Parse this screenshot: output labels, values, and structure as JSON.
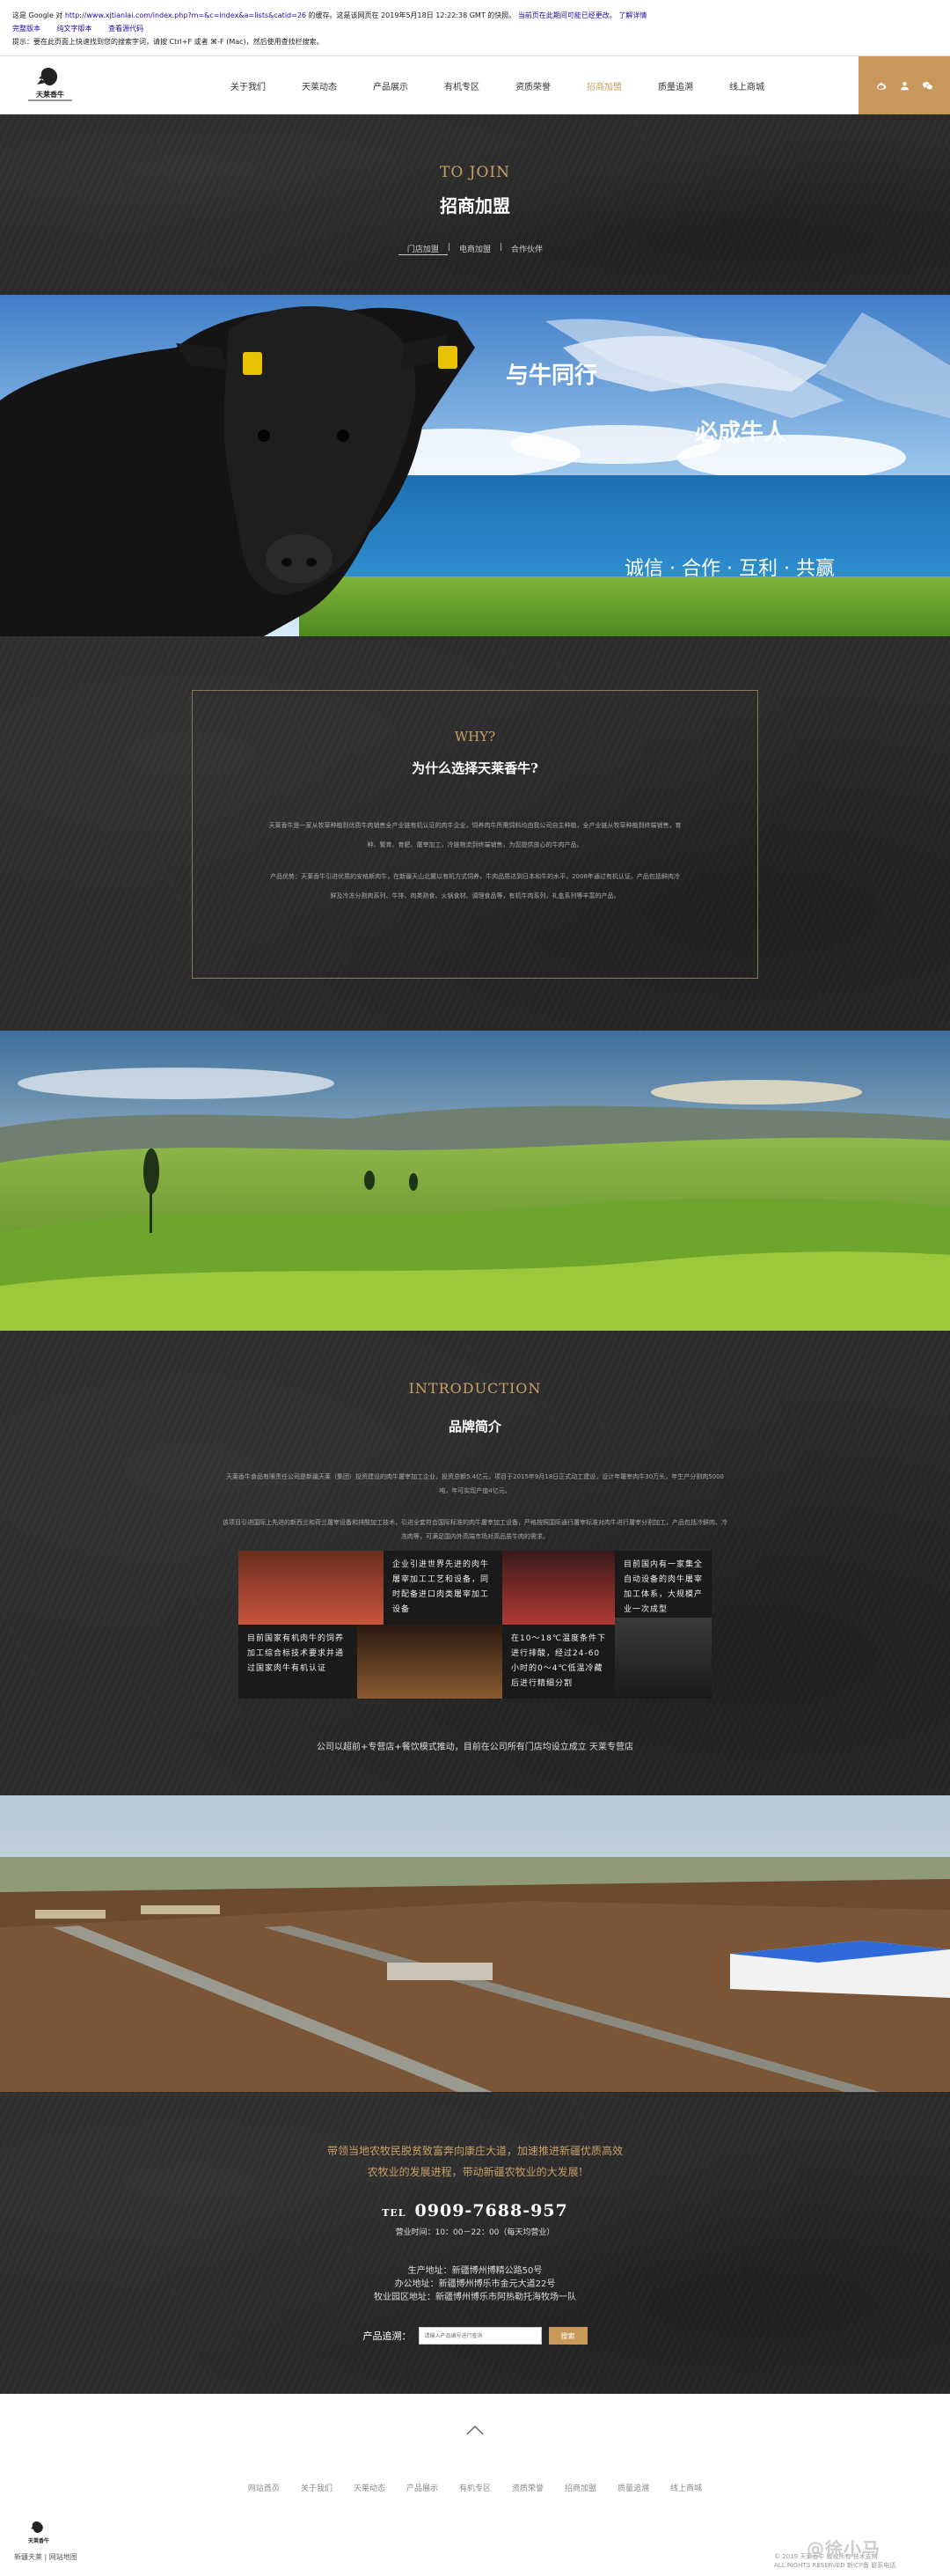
{
  "cache_bar": {
    "line1_prefix": "这是 Google 对",
    "url": "http://www.xjtianlai.com/index.php?m=&c=index&a=lists&catid=26",
    "line1_suffix": "的缓存。这是该网页在 2019年5月18日 12:22:38 GMT 的快照。",
    "line1_note": "当前页在此期间可能已经更改。",
    "learn_more": "了解详情",
    "full_version": "完整版本",
    "text_only": "纯文字版本",
    "view_source": "查看源代码",
    "tip": "提示：要在此页面上快速找到您的搜索字词，请按 Ctrl+F 或者 ⌘-F (Mac)，然后使用查找栏搜索。"
  },
  "nav": {
    "logo_text": "天莱香牛",
    "items": [
      "关于我们",
      "天莱动态",
      "产品展示",
      "有机专区",
      "资质荣誉",
      "招商加盟",
      "质量追溯",
      "线上商城"
    ],
    "active_index": 5,
    "accent": "#c8995a"
  },
  "join": {
    "title_en": "TO JOIN",
    "title_cn": "招商加盟",
    "tabs": [
      "门店加盟",
      "电商加盟",
      "合作伙伴"
    ]
  },
  "banner": {
    "slogan1": "与牛同行",
    "slogan2": "必成牛人",
    "values": "诚信 · 合作 · 互利 · 共赢"
  },
  "why": {
    "title_en": "WHY?",
    "title_cn": "为什么选择天莱香牛?",
    "p1": "天莱香牛是一家从牧草种植到优质牛肉销售全产业链有机认证的肉牛企业，饲养肉牛所需饲料均由我公司自主种植，全产业链从牧草种植到终端销售，育种、繁育、育肥、屠宰加工，冷链物流到终端销售，为您提供放心的牛肉产品。",
    "p2": "产品优势：天莱香牛引进优质的安格斯肉牛，在新疆天山北麓以有机方式饲养，牛肉品质达到日本和牛的水平，2008年通过有机认证。产品包括鲜肉冷鲜及冷冻分割肉系列、牛排、肉类熟食、火锅食材、调理食品等，有机牛肉系列，礼盒系列等丰富的产品。"
  },
  "intro": {
    "title_en": "INTRODUCTION",
    "title_cn": "品牌简介",
    "text1": "天莱香牛食品有限责任公司是新疆天莱（集团）投资建设的肉牛屠宰加工企业，投资总额5.4亿元，项目于2015年9月18日正式动工建设，设计年屠宰肉牛30万头，年生产分割肉5000吨，年可实现产值4亿元。",
    "text2": "该项目引进国际上先进的新西兰和荷兰屠宰设备和排酸加工技术，引进全套符合国际标准的肉牛屠宰加工设备，严格按照国际通行屠宰标准对肉牛进行屠宰分割加工，产品包括冷鲜肉、冷冻肉等，可满足国内外高端市场对高品质牛肉的需求。",
    "tile1": "企业引进世界先进的肉牛屠宰加工工艺和设备，同时配备进口肉类屠宰加工设备",
    "tile2": "目前国内有一家集全自动设备的肉牛屠宰加工体系，大规模产业一次成型",
    "tile3": "目前国家有机肉牛的饲养加工综合标技术要求并通过国家肉牛有机认证",
    "tile4": "在10～18℃温度条件下进行排酸，经过24-60小时的0～4℃低温冷藏后进行精细分割",
    "foot": "公司以超前+专营店+餐饮模式推动，目前在公司所有门店均设立成立 天莱专营店"
  },
  "contact": {
    "slogan1": "带领当地农牧民脱贫致富奔向康庄大道，加速推进新疆优质高效",
    "slogan2": "农牧业的发展进程，带动新疆农牧业的大发展!",
    "tel_label": "TEL",
    "tel": "0909-7688-957",
    "hours": "营业时间：10：00－22：00（每天均营业）",
    "addr1": "生产地址：新疆博州博精公路50号",
    "addr2": "办公地址：新疆博州博乐市金元大道22号",
    "addr3": "牧业园区地址：新疆博州博乐市阿热勒托海牧场一队",
    "trace_label": "产品追溯：",
    "trace_placeholder": "请输入产品编号进行查询",
    "trace_button": "搜索"
  },
  "footer": {
    "links": [
      "网站首页",
      "关于我们",
      "天莱动态",
      "产品展示",
      "有机专区",
      "资质荣誉",
      "招商加盟",
      "质量追溯",
      "线上商城"
    ],
    "logo_text": "天莱香牛",
    "copy": "新疆天莱  |  网站地图",
    "copyright1": "© 2019 天莱香牛 版权所有 技术支持",
    "copyright2": "ALL RIGHTS RESERVED 新ICP备 联系电话",
    "watermark": "@徐小马"
  }
}
